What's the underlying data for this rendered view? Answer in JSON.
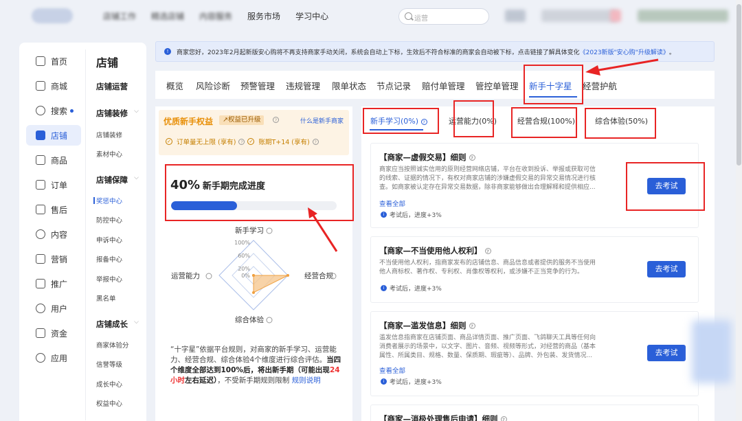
{
  "topnav": {
    "items": [
      "店铺工作",
      "精选店铺",
      "内容服务",
      "服务市场",
      "学习中心"
    ],
    "blurred_count": 3
  },
  "search": {
    "placeholder": "运营"
  },
  "sidebar": {
    "primary": [
      {
        "label": "首页",
        "icon": "home-icon"
      },
      {
        "label": "商城",
        "icon": "mall-icon"
      },
      {
        "label": "搜索",
        "icon": "search-icon",
        "dot": true
      },
      {
        "label": "店铺",
        "icon": "store-icon",
        "active": true
      },
      {
        "label": "商品",
        "icon": "product-icon"
      },
      {
        "label": "订单",
        "icon": "order-icon"
      },
      {
        "label": "售后",
        "icon": "aftersale-icon"
      },
      {
        "label": "内容",
        "icon": "content-icon"
      },
      {
        "label": "营销",
        "icon": "marketing-icon"
      },
      {
        "label": "推广",
        "icon": "promotion-icon"
      },
      {
        "label": "用户",
        "icon": "user-icon"
      },
      {
        "label": "资金",
        "icon": "fund-icon"
      },
      {
        "label": "应用",
        "icon": "app-icon"
      }
    ],
    "section_title": "店铺",
    "groups": [
      {
        "title": "店铺运营",
        "items": []
      },
      {
        "title": "店铺装修",
        "items": [
          "店铺装修",
          "素材中心"
        ]
      },
      {
        "title": "店铺保障",
        "items": [
          "奖惩中心",
          "防控中心",
          "申诉中心",
          "报备中心",
          "举报中心",
          "黑名单"
        ]
      },
      {
        "title": "店铺成长",
        "items": [
          "商家体验分",
          "信誉等级",
          "成长中心",
          "权益中心"
        ]
      }
    ]
  },
  "notice": {
    "text": "商家您好，2023年2月起新版安心购将不再支持商家手动关闭，系统会自动上下标，生效后不符合标准的商家会自动被下标，点击链接了解具体变化",
    "link": "《2023新版\"安心购\"升级解读》",
    "suffix": "。"
  },
  "tabs": [
    "概览",
    "风险诊断",
    "预警管理",
    "违规管理",
    "限单状态",
    "节点记录",
    "赔付单管理",
    "管控单管理",
    "新手十字星",
    "经营护航"
  ],
  "active_tab": "新手十字星",
  "benefit": {
    "title": "优质新手权益",
    "badge": "↗权益已升级",
    "link": "什么是新手商家",
    "items": [
      "订单量无上限 (享有)",
      "账期T+14 (享有)"
    ]
  },
  "progress": {
    "percent_label": "40%",
    "title": "新手期完成进度",
    "value": 0.4
  },
  "radar": {
    "axes": [
      "新手学习",
      "经营合规",
      "综合体验",
      "运营能力"
    ],
    "ticks": [
      "100%",
      "60%",
      "20%",
      "0%"
    ],
    "values": [
      0,
      1.0,
      0.5,
      0
    ]
  },
  "desc": {
    "p1": "“十字星”依据平台规则，对商家的新手学习、运营能力、经营合规、综合体验4个维度进行综合评估。",
    "p2": "当四个维度全部达到100%后，将出新手期（可能出现",
    "red": "24小时",
    "p3": "左右延迟）",
    "p4": "，不受新手期规则限制",
    "link": "规则说明"
  },
  "subtabs": [
    "新手学习(0%)",
    "运营能力(0%)",
    "经营合规(100%)",
    "综合体验(50%)"
  ],
  "cards": [
    {
      "title": "【商家—虚假交易】细则",
      "body": "商家应当按照诚实信用的原则经营网络店铺，平台在收到投诉、举报或获取可信的线索、证据的情况下，有权对商家店铺的涉嫌虚假交易的异常交易情况进行核查。如商家被认定存在异常交易数据，除非商家能够做出合理解释和提供相应...",
      "more": "查看全部",
      "tip": "考试后，进度+3%",
      "button": "去考试"
    },
    {
      "title": "【商家—不当使用他人权利】",
      "body": "不当使用他人权利，指商家发布的店铺信息、商品信息或者提供的服务不当使用他人商标权、著作权、专利权、肖像权等权利，或涉嫌不正当竞争的行为。",
      "more": "",
      "tip": "考试后，进度+3%",
      "button": "去考试"
    },
    {
      "title": "【商家—滥发信息】细则",
      "body": "滥发信息指商家在店铺页面、商品详情页面、推广页面、飞鸽聊天工具等任何向消费者展示的场景中，以文字、图片、音频、视频等形式，对经营的商品（基本属性、所属类目、规格、数量、保质期、瑕疵等）、品牌、外包装、发货情况...",
      "more": "查看全部",
      "tip": "考试后，进度+3%",
      "button": "去考试"
    },
    {
      "title": "【商家—消极处理售后申请】细则",
      "body": "",
      "more": "",
      "tip": "",
      "button": ""
    }
  ],
  "colors": {
    "accent": "#2a5fd8",
    "annotation": "#e82424",
    "benefit": "#e8900a"
  }
}
